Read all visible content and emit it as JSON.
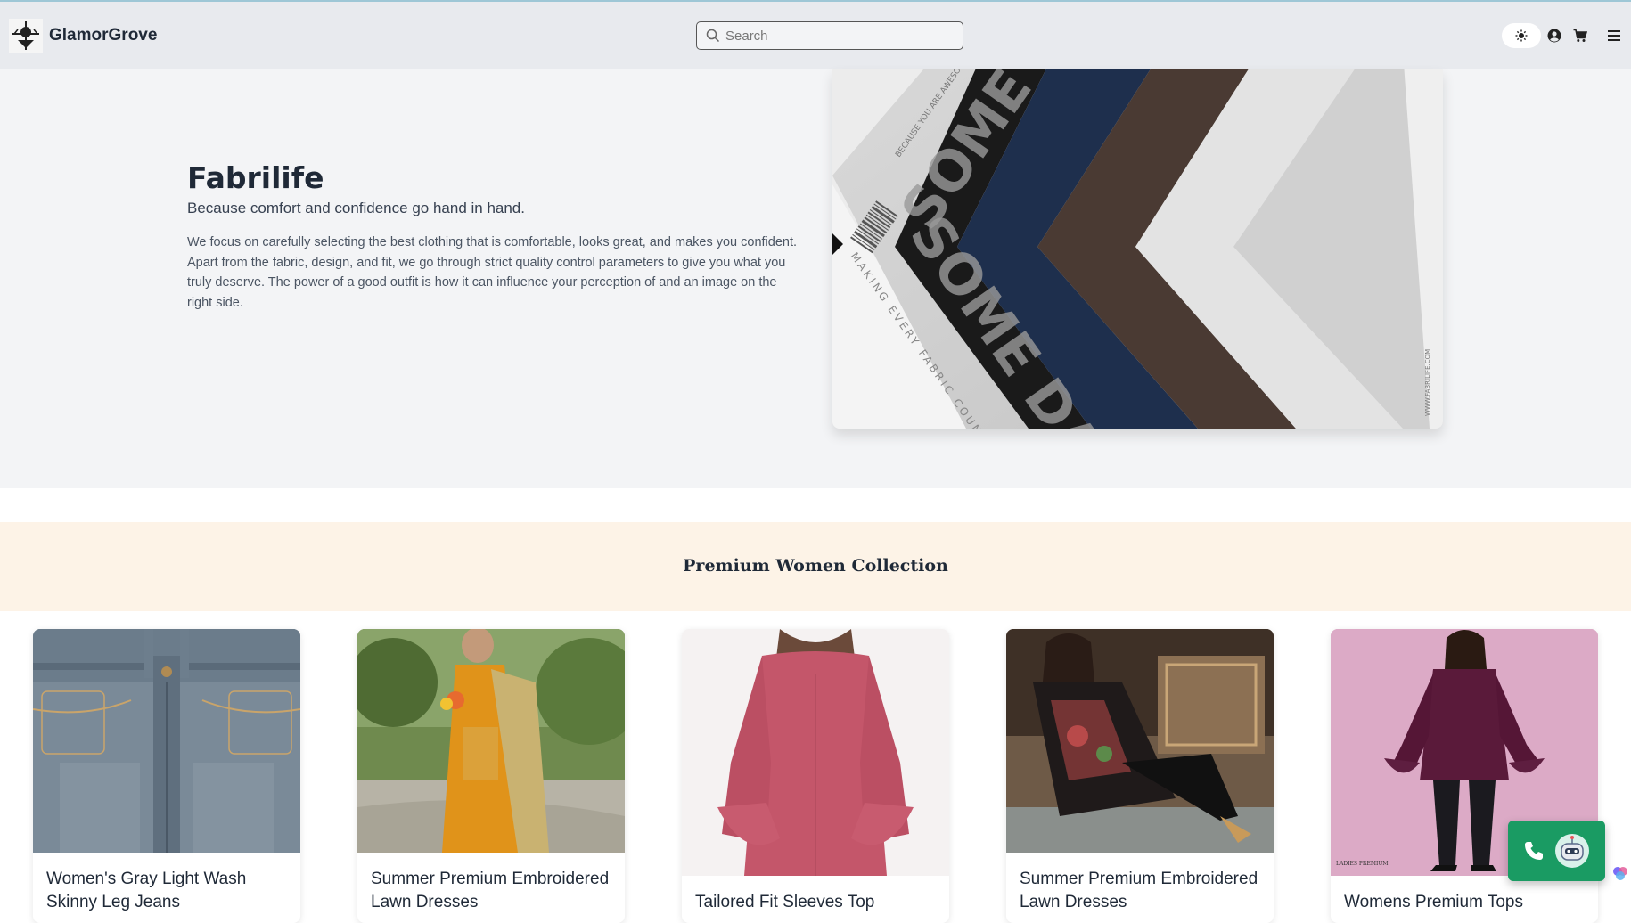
{
  "header": {
    "brand": "GlamorGrove",
    "search_placeholder": "Search",
    "icons": [
      "brightness-icon",
      "user-icon",
      "cart-icon",
      "menu-icon"
    ]
  },
  "hero": {
    "title": "Fabrilife",
    "subtitle": "Because comfort and confidence go hand in hand.",
    "body": "We focus on carefully selecting the best clothing that is comfortable, looks great, and makes you confident. Apart from the fabric, design, and fit, we go through strict quality control parameters to give you what you truly deserve. The power of a good outfit is how it can influence your perception of and an image on the right side.",
    "image_text": {
      "big1": "SOME LIGH",
      "big2": "SOME DARK",
      "tagline": "MAKING EVERY FABRIC COUNT",
      "small": "BECAUSE YOU ARE AWESOME",
      "url": "WWW.FABRILIFE.COM"
    }
  },
  "section": {
    "title": "Premium Women Collection"
  },
  "products": [
    {
      "name": "Women's Gray Light Wash Skinny Leg Jeans"
    },
    {
      "name": "Summer Premium Embroidered Lawn Dresses"
    },
    {
      "name": "Tailored Fit Sleeves Top"
    },
    {
      "name": "Summer Premium Embroidered Lawn Dresses"
    },
    {
      "name": "Womens Premium Tops"
    }
  ],
  "product_image_text": {
    "label": "LADIES PREMIUM"
  },
  "colors": {
    "header_bg": "#e8eaee",
    "hero_bg": "#f3f4f6",
    "section_band": "#fdf3e7",
    "call_widget": "#1a9b63"
  }
}
